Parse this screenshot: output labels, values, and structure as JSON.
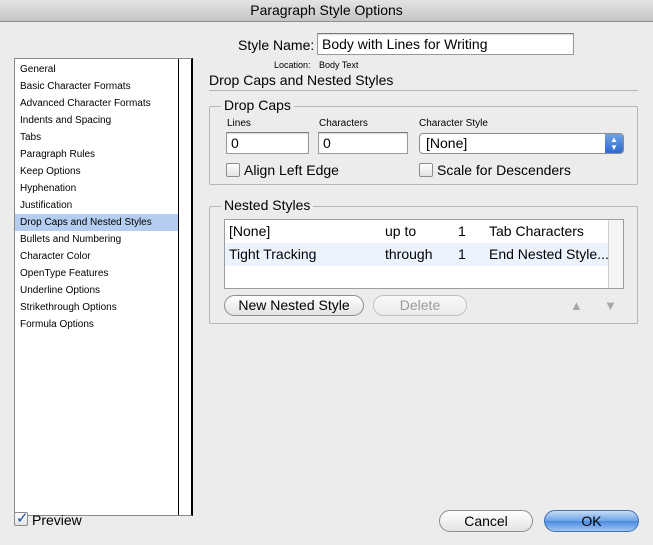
{
  "window": {
    "title": "Paragraph Style Options"
  },
  "sidebar": {
    "items": [
      {
        "label": "General"
      },
      {
        "label": "Basic Character Formats"
      },
      {
        "label": "Advanced Character Formats"
      },
      {
        "label": "Indents and Spacing"
      },
      {
        "label": "Tabs"
      },
      {
        "label": "Paragraph Rules"
      },
      {
        "label": "Keep Options"
      },
      {
        "label": "Hyphenation"
      },
      {
        "label": "Justification"
      },
      {
        "label": "Drop Caps and Nested Styles",
        "selected": true
      },
      {
        "label": "Bullets and Numbering"
      },
      {
        "label": "Character Color"
      },
      {
        "label": "OpenType Features"
      },
      {
        "label": "Underline Options"
      },
      {
        "label": "Strikethrough Options"
      },
      {
        "label": "Formula Options"
      }
    ]
  },
  "style_name": {
    "label": "Style Name:",
    "value": "Body with Lines for Writing",
    "location_label": "Location:",
    "location_value": "Body Text"
  },
  "section_title": "Drop Caps and Nested Styles",
  "drop_caps": {
    "legend": "Drop Caps",
    "lines_label": "Lines",
    "lines_value": "0",
    "characters_label": "Characters",
    "characters_value": "0",
    "char_style_label": "Character Style",
    "char_style_value": "[None]",
    "align_left_label": "Align Left Edge",
    "scale_descenders_label": "Scale for Descenders"
  },
  "nested_styles": {
    "legend": "Nested Styles",
    "rows": [
      {
        "style": "[None]",
        "mode": "up to",
        "count": "1",
        "delimiter": "Tab Characters"
      },
      {
        "style": "Tight Tracking",
        "mode": "through",
        "count": "1",
        "delimiter": "End Nested Style..."
      }
    ],
    "new_button": "New Nested Style",
    "delete_button": "Delete"
  },
  "footer": {
    "preview_label": "Preview",
    "cancel_label": "Cancel",
    "ok_label": "OK"
  },
  "icons": {
    "move_up": "▲",
    "move_down": "▼",
    "select_arrows": "▲▼",
    "check": "✓"
  }
}
